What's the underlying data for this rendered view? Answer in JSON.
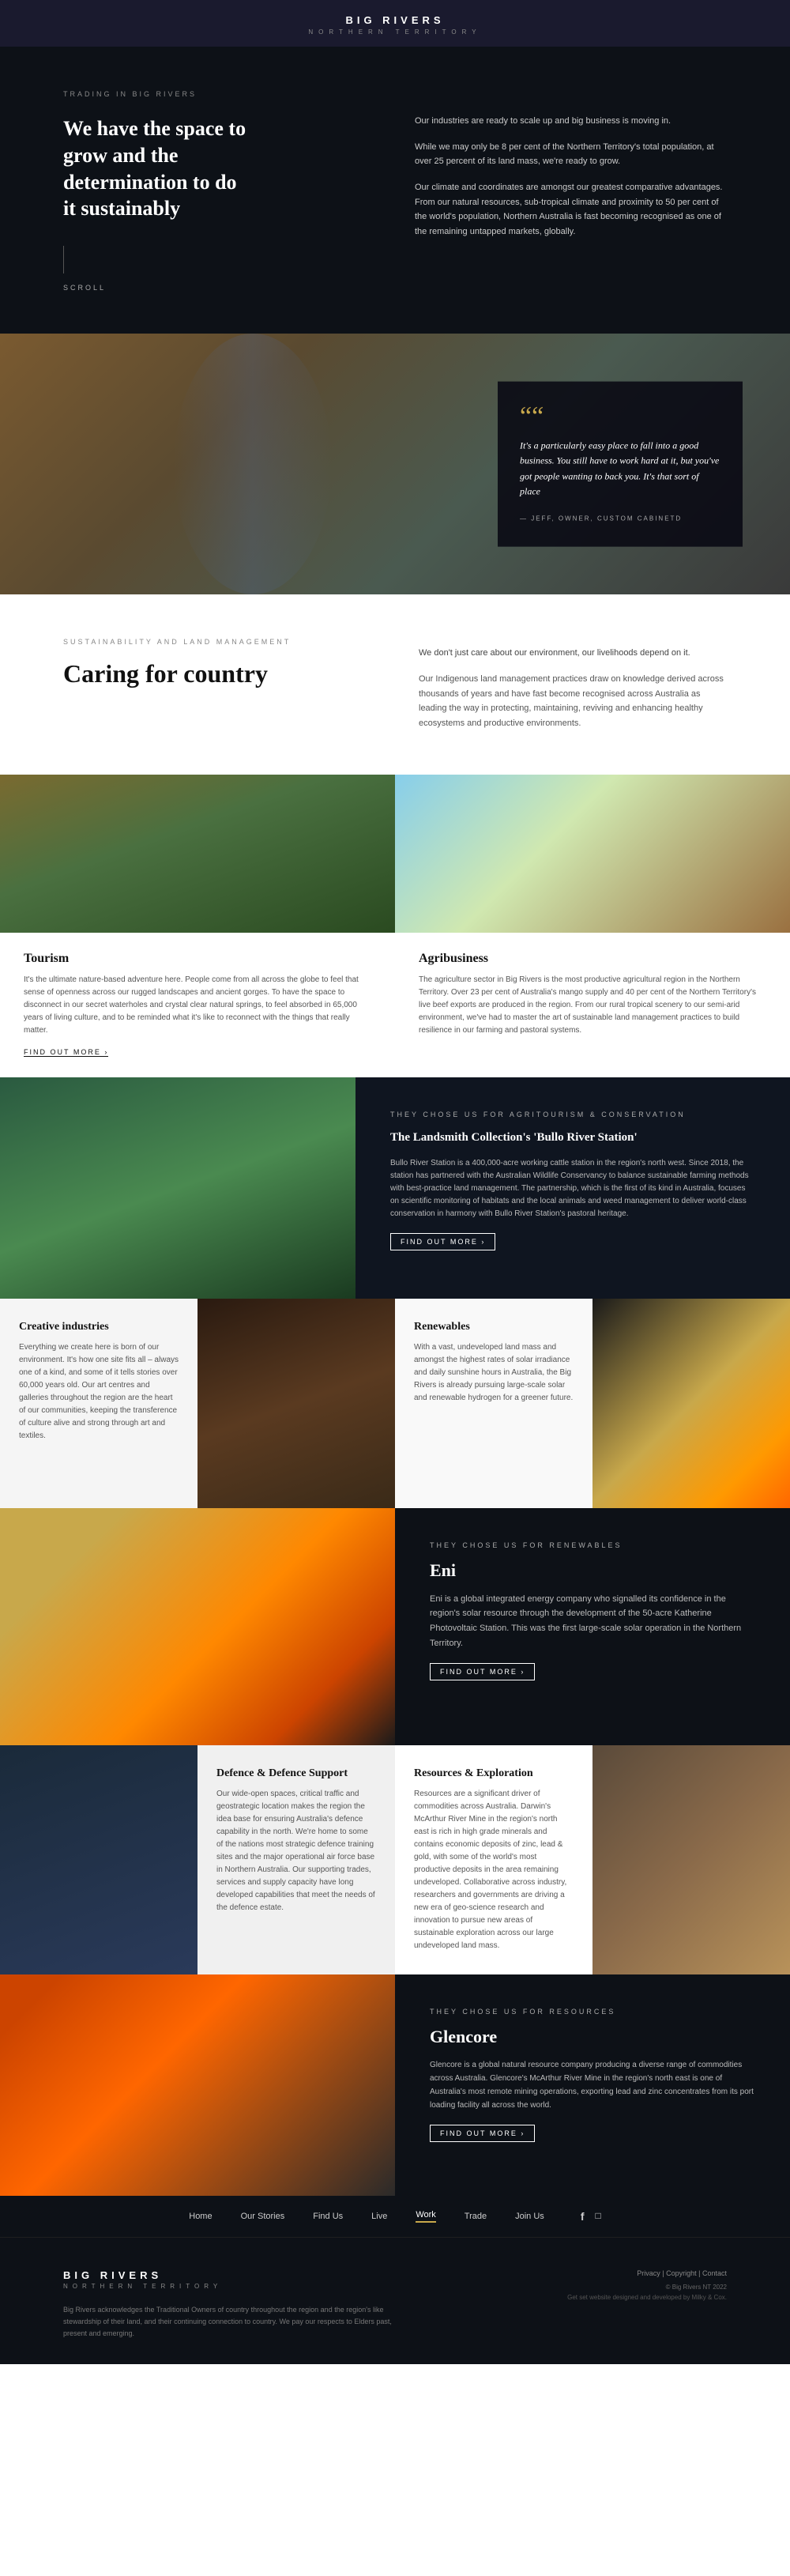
{
  "header": {
    "logo": "BIG RIVERS",
    "sub": "NORTHERN TERRITORY"
  },
  "hero": {
    "tag": "TRADING IN BIG RIVERS",
    "title_line1": "We have the space to",
    "title_line2": "grow and the",
    "title_line3": "determination to do",
    "title_line4": "it sustainably",
    "scroll_label": "SCROLL",
    "body_p1": "Our industries are ready to scale up and big business is moving in.",
    "body_p2": "While we may only be 8 per cent of the Northern Territory's total population, at over 25 percent of its land mass, we're ready to grow.",
    "body_p3": "Our climate and coordinates are amongst our greatest comparative advantages. From our natural resources, sub-tropical climate and proximity to 50 per cent of the world's population, Northern Australia is fast becoming recognised as one of the remaining untapped markets, globally."
  },
  "quote": {
    "mark": "““",
    "text": "It's a particularly easy place to fall into a good business. You still have to work hard at it, but you've got people wanting to back you. It's that sort of place",
    "attribution": "— JEFF, OWNER, CUSTOM CABINETD"
  },
  "caring": {
    "tag": "SUSTAINABILITY AND LAND MANAGEMENT",
    "title": "Caring for country",
    "body_p1": "We don't just care about our environment, our livelihoods depend on it.",
    "body_p2": "Our Indigenous land management practices draw on knowledge derived across thousands of years and have fast become recognised across Australia as leading the way in protecting, maintaining, reviving and enhancing healthy ecosystems and productive environments."
  },
  "tourism": {
    "title": "Tourism",
    "body": "It's the ultimate nature-based adventure here. People come from all across the globe to feel that sense of openness across our rugged landscapes and ancient gorges. To have the space to disconnect in our secret waterholes and crystal clear natural springs, to feel absorbed in 65,000 years of living culture, and to be reminded what it's like to reconnect with the things that really matter.",
    "link": "FIND OUT MORE ›"
  },
  "agribusiness": {
    "title": "Agribusiness",
    "body": "The agriculture sector in Big Rivers is the most productive agricultural region in the Northern Territory. Over 23 per cent of Australia's mango supply and 40 per cent of the Northern Territory's live beef exports are produced in the region. From our rural tropical scenery to our semi-arid environment, we've had to master the art of sustainable land management practices to build resilience in our farming and pastoral systems.",
    "link": ""
  },
  "landsmith": {
    "tag": "THEY CHOSE US FOR AGRITOURISM & CONSERVATION",
    "title": "The Landsmith Collection's 'Bullo River Station'",
    "body": "Bullo River Station is a 400,000-acre working cattle station in the region's north west. Since 2018, the station has partnered with the Australian Wildlife Conservancy to balance sustainable farming methods with best-practice land management. The partnership, which is the first of its kind in Australia, focuses on scientific monitoring of habitats and the local animals and weed management to deliver world-class conservation in harmony with Bullo River Station's pastoral heritage.",
    "link": "FIND OUT MORE ›"
  },
  "creative": {
    "title": "Creative industries",
    "body": "Everything we create here is born of our environment. It's how one site fits all – always one of a kind, and some of it tells stories over 60,000 years old. Our art centres and galleries throughout the region are the heart of our communities, keeping the transference of culture alive and strong through art and textiles."
  },
  "renewables": {
    "title": "Renewables",
    "body": "With a vast, undeveloped land mass and amongst the highest rates of solar irradiance and daily sunshine hours in Australia, the Big Rivers is already pursuing large-scale solar and renewable hydrogen for a greener future."
  },
  "eni": {
    "tag": "THEY CHOSE US FOR RENEWABLES",
    "title": "Eni",
    "body": "Eni is a global integrated energy company who signalled its confidence in the region's solar resource through the development of the 50-acre Katherine Photovoltaic Station. This was the first large-scale solar operation in the Northern Territory.",
    "link": "FIND OUT MORE ›"
  },
  "defence": {
    "title": "Defence & Defence Support",
    "body": "Our wide-open spaces, critical traffic and geostrategic location makes the region the idea base for ensuring Australia's defence capability in the north. We're home to some of the nations most strategic defence training sites and the major operational air force base in Northern Australia. Our supporting trades, services and supply capacity have long developed capabilities that meet the needs of the defence estate."
  },
  "resources": {
    "title": "Resources & Exploration",
    "body": "Resources are a significant driver of commodities across Australia. Darwin's McArthur River Mine in the region's north east is rich in high grade minerals and contains economic deposits of zinc, lead & gold, with some of the world's most productive deposits in the area remaining undeveloped. Collaborative across industry, researchers and governments are driving a new era of geo-science research and innovation to pursue new areas of sustainable exploration across our large undeveloped land mass."
  },
  "glencore": {
    "tag": "THEY CHOSE US FOR RESOURCES",
    "title": "Glencore",
    "body": "Glencore is a global natural resource company producing a diverse range of commodities across Australia. Glencore's McArthur River Mine in the region's north east is one of Australia's most remote mining operations, exporting lead and zinc concentrates from its port loading facility all across the world.",
    "link": "FIND OUT MORE ›"
  },
  "nav": {
    "items": [
      {
        "label": "Home",
        "active": false
      },
      {
        "label": "Our Stories",
        "active": false
      },
      {
        "label": "Find Us",
        "active": false
      },
      {
        "label": "Live",
        "active": false
      },
      {
        "label": "Work",
        "active": true
      },
      {
        "label": "Trade",
        "active": false
      },
      {
        "label": "Join Us",
        "active": false
      }
    ],
    "social_f": "f",
    "social_ig": "◻"
  },
  "footer": {
    "logo": "BIG RIVERS",
    "sub": "NORTHERN TERRITORY",
    "acknowledge": "Big Rivers acknowledges the Traditional Owners of country throughout the region and the region's like stewardship of their land, and their continuing connection to country. We pay our respects to Elders past, present and emerging.",
    "privacy": "Privacy  |  Copyright  |  Contact",
    "credit": "© Big Rivers NT 2022",
    "design": "Get set website designed and developed by Milky & Cox."
  }
}
